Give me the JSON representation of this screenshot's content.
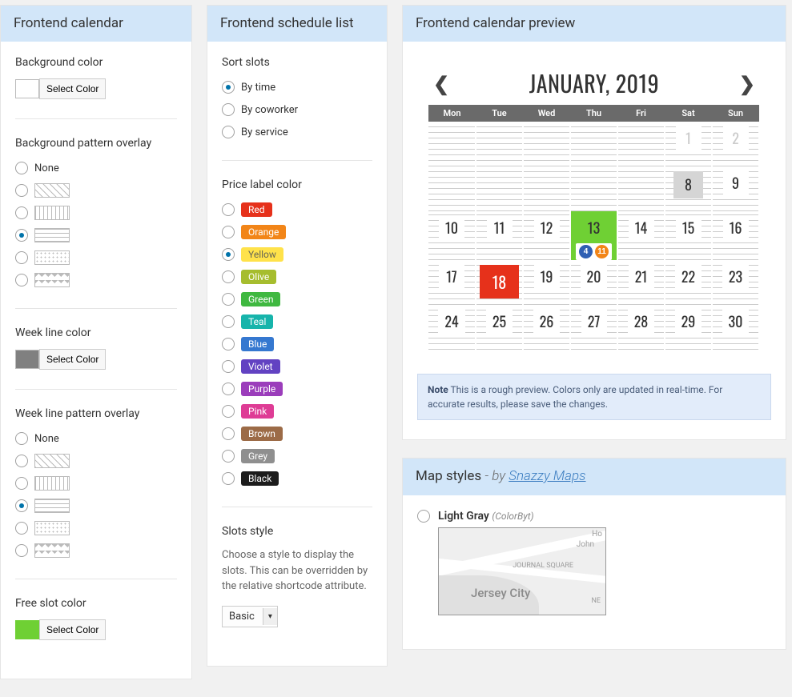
{
  "panels": {
    "frontend_calendar": {
      "title": "Frontend calendar"
    },
    "frontend_schedule_list": {
      "title": "Frontend schedule list"
    },
    "frontend_calendar_preview": {
      "title": "Frontend calendar preview"
    },
    "map_styles": {
      "title": "Map styles",
      "byline_prefix": "- by ",
      "byline_link": "Snazzy Maps"
    }
  },
  "frontend_calendar": {
    "bg_color": {
      "label": "Background color",
      "btn": "Select Color",
      "value": "#ffffff"
    },
    "bg_pattern": {
      "label": "Background pattern overlay",
      "options": [
        "None",
        "diag",
        "vert",
        "horiz",
        "dots",
        "zigzag"
      ],
      "selected_index": 3
    },
    "week_line_color": {
      "label": "Week line color",
      "btn": "Select Color",
      "value": "#808080"
    },
    "week_line_pattern": {
      "label": "Week line pattern overlay",
      "options": [
        "None",
        "diag",
        "vert",
        "horiz",
        "dots",
        "zigzag"
      ],
      "selected_index": 3
    },
    "free_slot_color": {
      "label": "Free slot color",
      "btn": "Select Color",
      "value": "#6fd034"
    }
  },
  "frontend_schedule_list": {
    "sort_slots": {
      "label": "Sort slots",
      "options": [
        "By time",
        "By coworker",
        "By service"
      ],
      "selected_index": 0
    },
    "price_label_color": {
      "label": "Price label color",
      "options": [
        "Red",
        "Orange",
        "Yellow",
        "Olive",
        "Green",
        "Teal",
        "Blue",
        "Violet",
        "Purple",
        "Pink",
        "Brown",
        "Grey",
        "Black"
      ],
      "selected_index": 2
    },
    "slots_style": {
      "label": "Slots style",
      "desc": "Choose a style to display the slots. This can be overridden by the relative shortcode attribute.",
      "value": "Basic"
    }
  },
  "calendar_preview": {
    "title": "JANUARY, 2019",
    "weekdays": [
      "Mon",
      "Tue",
      "Wed",
      "Thu",
      "Fri",
      "Sat",
      "Sun"
    ],
    "rows": [
      [
        {
          "n": ""
        },
        {
          "n": ""
        },
        {
          "n": ""
        },
        {
          "n": ""
        },
        {
          "n": ""
        },
        {
          "n": "1",
          "muted": true
        },
        {
          "n": "2",
          "muted": true
        }
      ],
      [
        {
          "n": ""
        },
        {
          "n": ""
        },
        {
          "n": ""
        },
        {
          "n": ""
        },
        {
          "n": ""
        },
        {
          "n": "8",
          "grey": true
        },
        {
          "n": "9"
        }
      ],
      [
        {
          "n": "10"
        },
        {
          "n": "11"
        },
        {
          "n": "12"
        },
        {
          "n": "13",
          "green": true,
          "badges": [
            "4",
            "11"
          ]
        },
        {
          "n": "14"
        },
        {
          "n": "15"
        },
        {
          "n": "16"
        }
      ],
      [
        {
          "n": "17"
        },
        {
          "n": "18",
          "red": true
        },
        {
          "n": "19"
        },
        {
          "n": "20"
        },
        {
          "n": "21"
        },
        {
          "n": "22"
        },
        {
          "n": "23"
        }
      ],
      [
        {
          "n": "24"
        },
        {
          "n": "25"
        },
        {
          "n": "26"
        },
        {
          "n": "27"
        },
        {
          "n": "28"
        },
        {
          "n": "29"
        },
        {
          "n": "30"
        }
      ]
    ],
    "note_bold": "Note",
    "note_text": " This is a rough preview. Colors only are updated in real-time. For accurate results, please save the changes."
  },
  "map_styles": {
    "item1": {
      "name": "Light Gray",
      "author": "(ColorByt)",
      "city_label": "Jersey City",
      "sq_label": "JOURNAL SQUARE",
      "p1": "John",
      "p2": "Ho",
      "ne": "NE"
    }
  }
}
